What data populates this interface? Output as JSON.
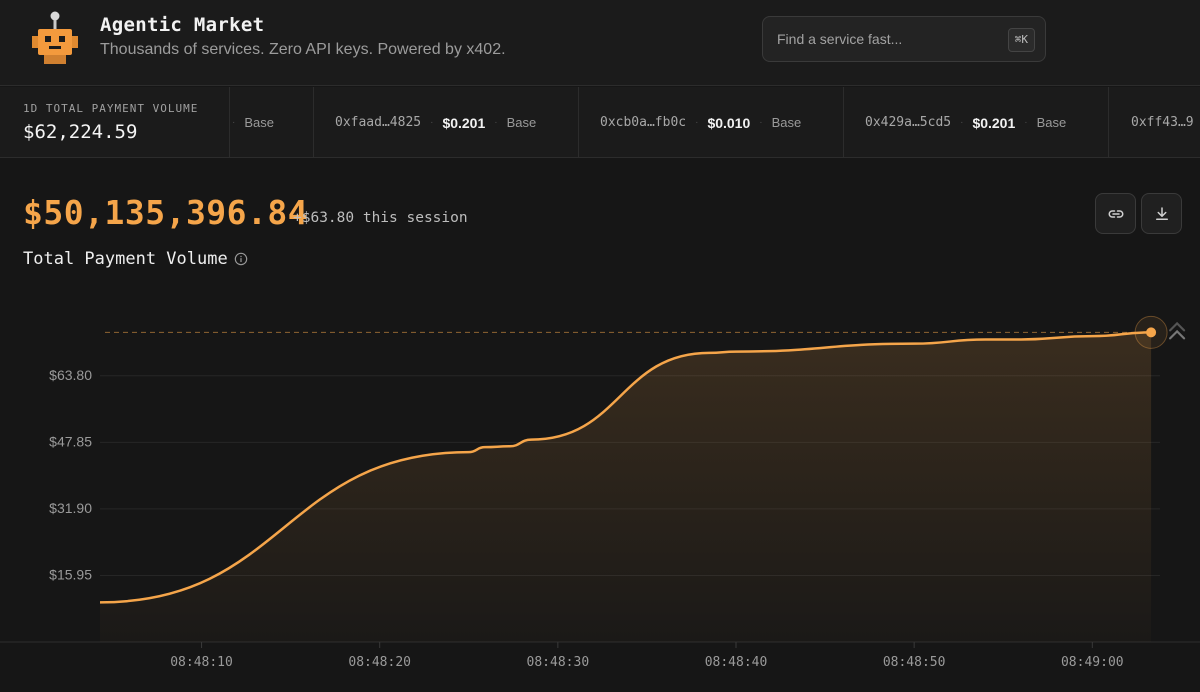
{
  "app": {
    "title": "Agentic Market",
    "subtitle": "Thousands of services. Zero API keys. Powered by x402."
  },
  "search": {
    "placeholder": "Find a service fast...",
    "shortcut": "⌘K"
  },
  "ticker": {
    "total_label": "1D TOTAL PAYMENT VOLUME",
    "total_value": "$62,224.59",
    "items": [
      {
        "address": "",
        "price": "",
        "network": "Base"
      },
      {
        "address": "0xfaad…4825",
        "price": "$0.201",
        "network": "Base"
      },
      {
        "address": "0xcb0a…fb0c",
        "price": "$0.010",
        "network": "Base"
      },
      {
        "address": "0x429a…5cd5",
        "price": "$0.201",
        "network": "Base"
      },
      {
        "address": "0xff43…9",
        "price": "",
        "network": ""
      }
    ]
  },
  "stats": {
    "total_volume": "$50,135,396.84",
    "session_delta": "+$63.80 this session"
  },
  "actions": {
    "link_icon": "link-icon",
    "download_icon": "download-icon"
  },
  "chart_title": "Total Payment Volume",
  "colors": {
    "accent": "#f5a54a",
    "background": "#161616",
    "panel": "#1b1b1b"
  },
  "chart_data": {
    "type": "area",
    "ylim": [
      0,
      63.8
    ],
    "y_ticks": [
      "$63.80",
      "$47.85",
      "$31.90",
      "$15.95"
    ],
    "y_tick_values": [
      63.8,
      47.85,
      31.9,
      15.95
    ],
    "x_ticks": [
      "08:48:10",
      "08:48:20",
      "08:48:30",
      "08:48:40",
      "08:48:50",
      "08:49:00"
    ],
    "x_tick_seconds": [
      10,
      20,
      30,
      40,
      50,
      60
    ],
    "x_range": [
      4.3,
      63.8
    ],
    "series": [
      {
        "x": [
          4.3,
          25.0,
          25.9,
          27.3,
          28.5,
          38.5,
          40.0,
          50.0,
          54.0,
          56.0,
          60.0,
          63.3
        ],
        "y": [
          9.5,
          45.5,
          46.7,
          46.9,
          48.5,
          69.3,
          69.6,
          71.5,
          72.5,
          72.5,
          73.3,
          74.2
        ]
      }
    ],
    "reference_line": 74.2,
    "current_value": 74.2,
    "grid": true
  }
}
